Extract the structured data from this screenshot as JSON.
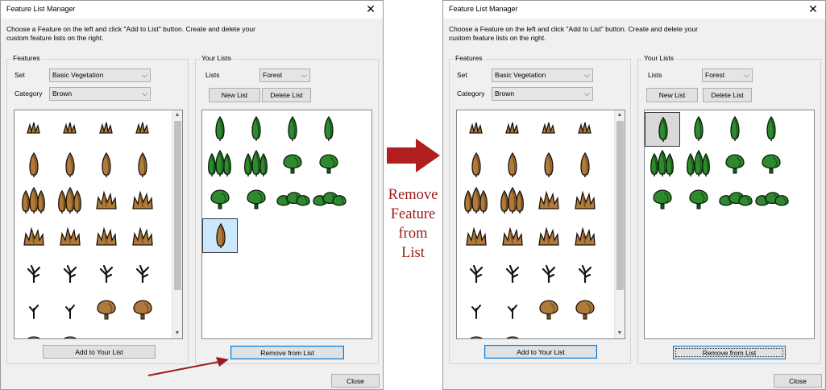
{
  "colors": {
    "dialog_bg": "#f0f0f0",
    "arrow_red": "#b01e1e",
    "label_red": "#9b1b1b",
    "selected_blue": "#cce8ff",
    "selected_grey": "#d9d9d9",
    "tree_green": "#2f8a2f",
    "bush_brown": "#b07a3a"
  },
  "annotation": {
    "label_lines": [
      "Remove",
      "Feature",
      "from",
      "List"
    ]
  },
  "dialog_left": {
    "title": "Feature List Manager",
    "close_glyph": "✕",
    "instructions": "Choose a Feature on the left and click \"Add to List\" button. Create and delete your custom feature lists on the right.",
    "features_group": "Features",
    "set_label": "Set",
    "set_value": "Basic Vegetation",
    "category_label": "Category",
    "category_value": "Brown",
    "add_button": "Add to Your List",
    "lists_group": "Your Lists",
    "lists_label": "Lists",
    "lists_value": "Forest",
    "new_list_button": "New List",
    "delete_list_button": "Delete List",
    "remove_button": "Remove from List",
    "close_button": "Close"
  },
  "dialog_right": {
    "title": "Feature List Manager",
    "close_glyph": "✕",
    "instructions": "Choose a Feature on the left and click \"Add to List\" button. Create and delete your custom feature lists on the right.",
    "features_group": "Features",
    "set_label": "Set",
    "set_value": "Basic Vegetation",
    "category_label": "Category",
    "category_value": "Brown",
    "add_button": "Add to Your List",
    "lists_group": "Your Lists",
    "lists_label": "Lists",
    "lists_value": "Forest",
    "new_list_button": "New List",
    "delete_list_button": "Delete List",
    "remove_button": "Remove from List",
    "close_button": "Close"
  },
  "features_icons": [
    "tuft",
    "tuft",
    "tuft",
    "tuft",
    "cypress",
    "cypress",
    "cypress",
    "cypress",
    "cypress-cluster",
    "cypress-cluster",
    "shrub",
    "shrub",
    "shrub",
    "shrub",
    "shrub",
    "shrub",
    "dead-branch",
    "dead-branch",
    "dead-branch",
    "dead-branch",
    "twig",
    "twig",
    "round-tree",
    "round-tree",
    "round-tree",
    "round-tree",
    "bush-group",
    "bush-group"
  ],
  "list_icons_left": [
    {
      "icon": "cypress",
      "color": "green"
    },
    {
      "icon": "cypress",
      "color": "green"
    },
    {
      "icon": "cypress",
      "color": "green"
    },
    {
      "icon": "cypress",
      "color": "green"
    },
    {
      "icon": "cypress-cluster",
      "color": "green"
    },
    {
      "icon": "cypress-cluster",
      "color": "green"
    },
    {
      "icon": "round-tree",
      "color": "green"
    },
    {
      "icon": "round-tree",
      "color": "green"
    },
    {
      "icon": "round-tree",
      "color": "green"
    },
    {
      "icon": "round-tree",
      "color": "green"
    },
    {
      "icon": "bush-group",
      "color": "green"
    },
    {
      "icon": "bush-group",
      "color": "green"
    },
    {
      "icon": "cypress",
      "color": "brown",
      "selected": true
    }
  ],
  "list_icons_right": [
    {
      "icon": "cypress",
      "color": "green",
      "selected": true
    },
    {
      "icon": "cypress",
      "color": "green"
    },
    {
      "icon": "cypress",
      "color": "green"
    },
    {
      "icon": "cypress",
      "color": "green"
    },
    {
      "icon": "cypress-cluster",
      "color": "green"
    },
    {
      "icon": "cypress-cluster",
      "color": "green"
    },
    {
      "icon": "round-tree",
      "color": "green"
    },
    {
      "icon": "round-tree",
      "color": "green"
    },
    {
      "icon": "round-tree",
      "color": "green"
    },
    {
      "icon": "round-tree",
      "color": "green"
    },
    {
      "icon": "bush-group",
      "color": "green"
    },
    {
      "icon": "bush-group",
      "color": "green"
    }
  ]
}
